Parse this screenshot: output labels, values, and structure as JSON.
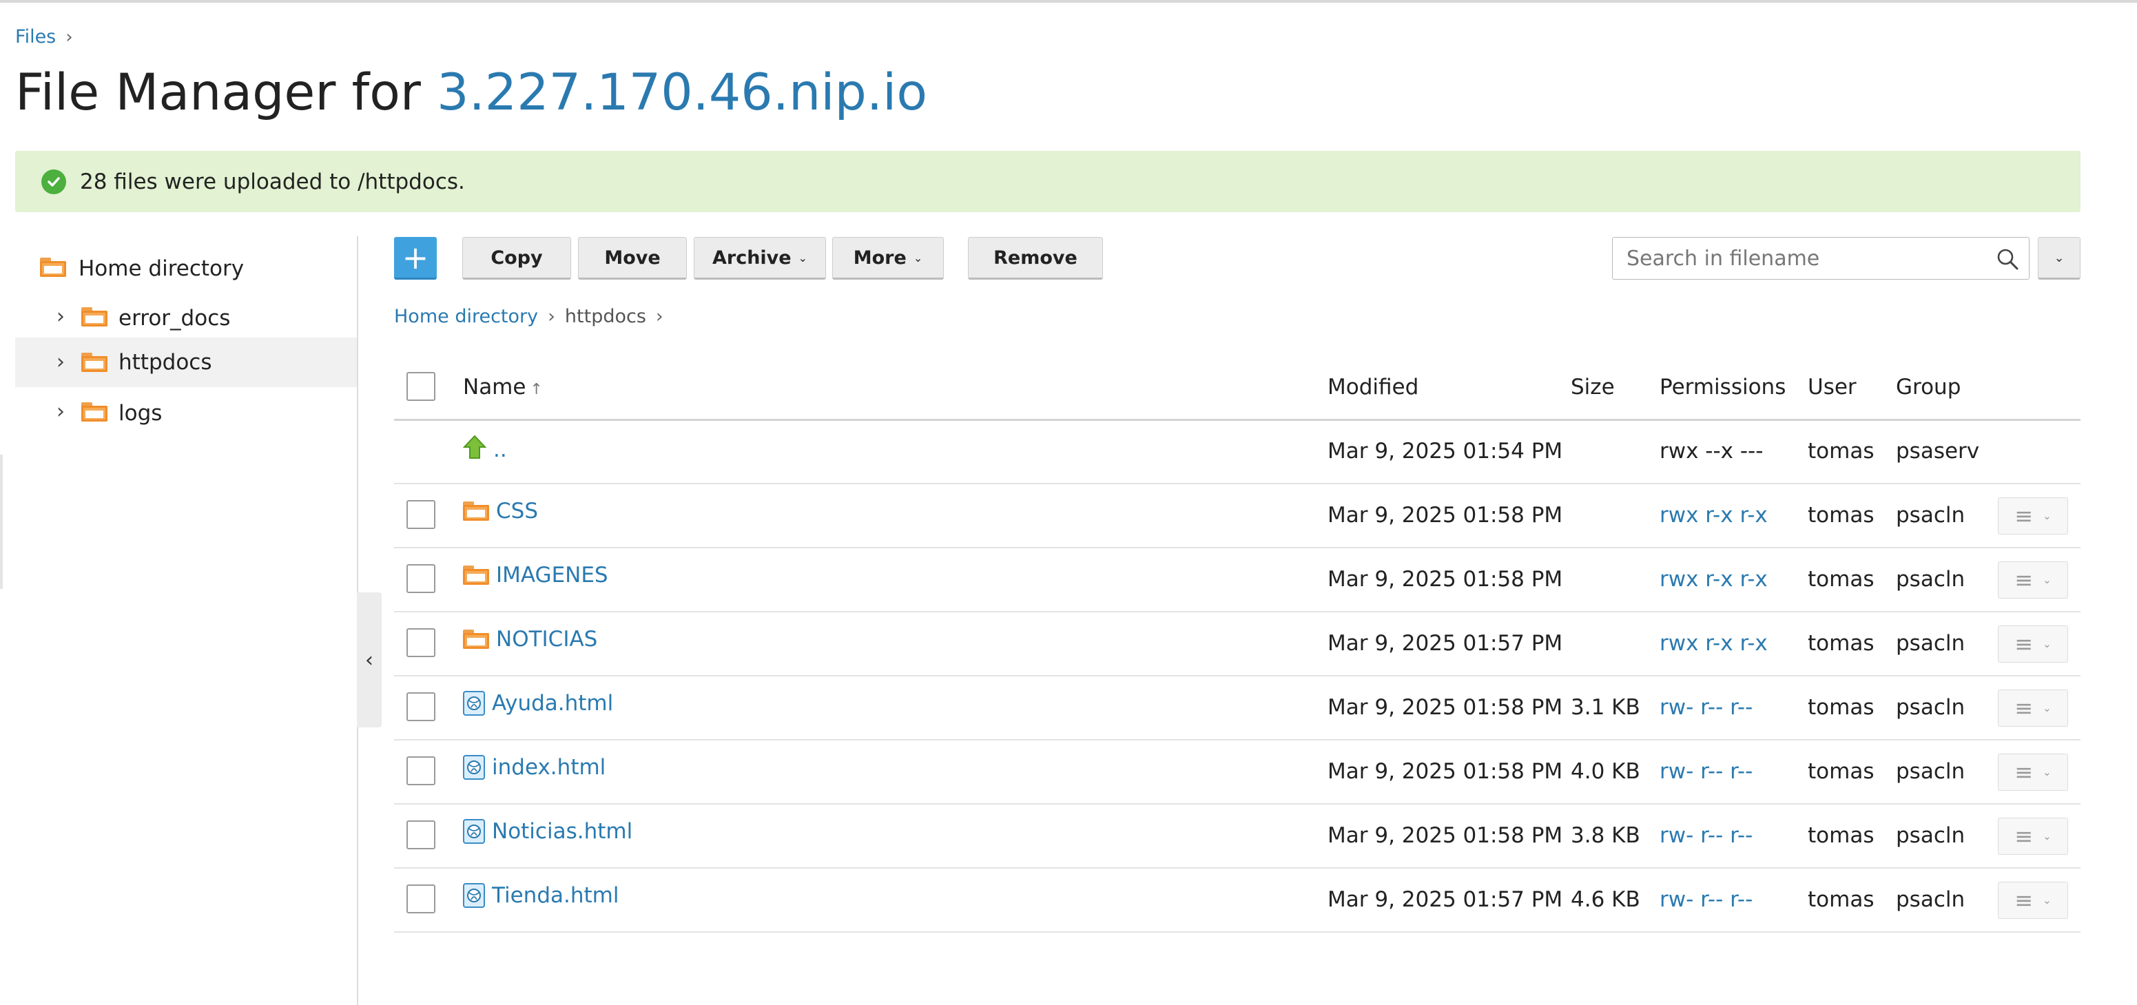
{
  "breadcrumb_top": {
    "label": "Files"
  },
  "title": {
    "prefix": "File Manager for ",
    "host": "3.227.170.46.nip.io"
  },
  "alert": {
    "message": "28 files were uploaded to /httpdocs."
  },
  "tree": {
    "root": "Home directory",
    "items": [
      {
        "label": "error_docs"
      },
      {
        "label": "httpdocs"
      },
      {
        "label": "logs"
      }
    ]
  },
  "toolbar": {
    "add_label": "+",
    "copy": "Copy",
    "move": "Move",
    "archive": "Archive",
    "more": "More",
    "remove": "Remove",
    "search_placeholder": "Search in filename"
  },
  "path": {
    "home": "Home directory",
    "current": "httpdocs"
  },
  "columns": {
    "name": "Name",
    "name_sort": "↑",
    "modified": "Modified",
    "size": "Size",
    "permissions": "Permissions",
    "user": "User",
    "group": "Group"
  },
  "rows": [
    {
      "name": "..",
      "modified": "Mar 9, 2025 01:54 PM",
      "size": "",
      "permissions": "rwx --x ---",
      "user": "tomas",
      "group": "psaserv"
    },
    {
      "name": "CSS",
      "modified": "Mar 9, 2025 01:58 PM",
      "size": "",
      "permissions": "rwx r-x r-x",
      "user": "tomas",
      "group": "psacln"
    },
    {
      "name": "IMAGENES",
      "modified": "Mar 9, 2025 01:58 PM",
      "size": "",
      "permissions": "rwx r-x r-x",
      "user": "tomas",
      "group": "psacln"
    },
    {
      "name": "NOTICIAS",
      "modified": "Mar 9, 2025 01:57 PM",
      "size": "",
      "permissions": "rwx r-x r-x",
      "user": "tomas",
      "group": "psacln"
    },
    {
      "name": "Ayuda.html",
      "modified": "Mar 9, 2025 01:58 PM",
      "size": "3.1 KB",
      "permissions": "rw- r-- r--",
      "user": "tomas",
      "group": "psacln"
    },
    {
      "name": "index.html",
      "modified": "Mar 9, 2025 01:58 PM",
      "size": "4.0 KB",
      "permissions": "rw- r-- r--",
      "user": "tomas",
      "group": "psacln"
    },
    {
      "name": "Noticias.html",
      "modified": "Mar 9, 2025 01:58 PM",
      "size": "3.8 KB",
      "permissions": "rw- r-- r--",
      "user": "tomas",
      "group": "psacln"
    },
    {
      "name": "Tienda.html",
      "modified": "Mar 9, 2025 01:57 PM",
      "size": "4.6 KB",
      "permissions": "rw- r-- r--",
      "user": "tomas",
      "group": "psacln"
    }
  ],
  "colors": {
    "link": "#2a7ab0",
    "success_bg": "#e2f2d2",
    "success_icon": "#4caf3e",
    "primary": "#3fa2de",
    "folder": "#f6aa55"
  }
}
